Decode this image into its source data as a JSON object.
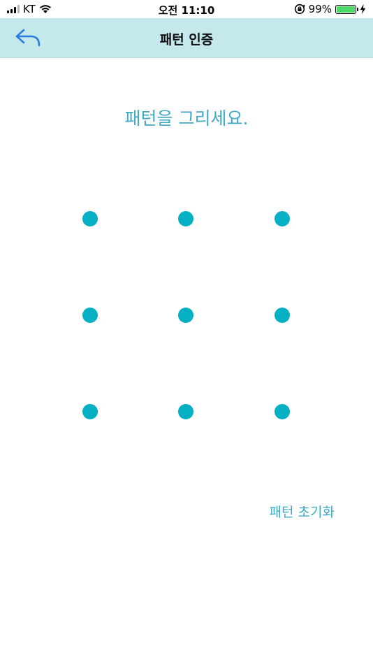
{
  "status_bar": {
    "carrier": "KT",
    "time": "오전 11:10",
    "battery_percent": "99%",
    "battery_level": 0.99,
    "signal_bars_active": 3,
    "signal_bars_total": 4,
    "icons": [
      "signal-icon",
      "wifi-icon",
      "orientation-lock-icon",
      "battery-icon",
      "charging-icon"
    ]
  },
  "nav": {
    "title": "패턴 인증",
    "back_icon": "reply-back-arrow-icon"
  },
  "content": {
    "prompt": "패턴을 그리세요.",
    "pattern_dots_count": 9,
    "reset_label": "패턴 초기화"
  },
  "colors": {
    "nav_background": "#c5e8ec",
    "accent_text": "#3eaac3",
    "dot": "#06b0c4",
    "back_icon": "#2a7de1"
  }
}
